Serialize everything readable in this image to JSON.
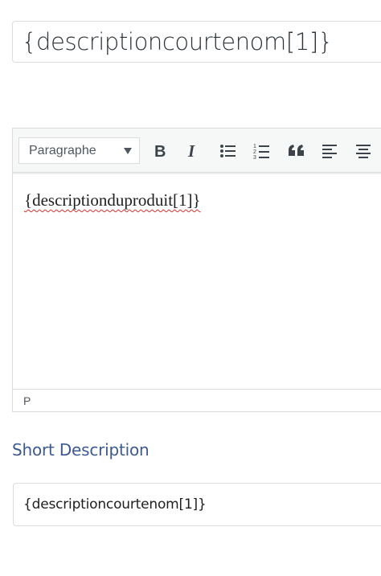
{
  "title_field": {
    "value": "{descriptioncourtenom[1]}"
  },
  "editor": {
    "format_select": {
      "selected": "Paragraphe"
    },
    "toolbar_buttons": [
      "bold-icon",
      "italic-icon",
      "bullet-list-icon",
      "numbered-list-icon",
      "blockquote-icon",
      "align-left-icon",
      "align-center-icon"
    ],
    "content_text": "{descriptionduproduit[1]}",
    "statusbar_path": "P"
  },
  "short_description": {
    "heading": "Short Description",
    "value": "{descriptioncourtenom[1]}"
  },
  "colors": {
    "heading": "#3c5a91",
    "border": "#dcdcde",
    "toolbar_bg": "#f6f7f7"
  }
}
